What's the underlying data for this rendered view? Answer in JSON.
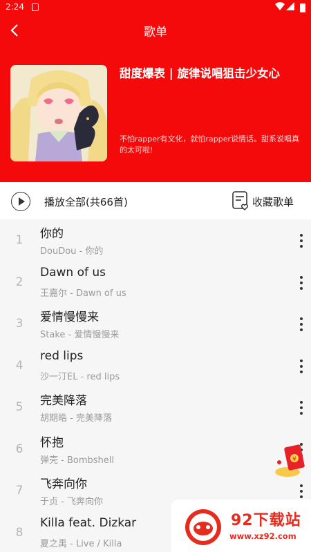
{
  "status_bar": {
    "time": "2:24"
  },
  "nav": {
    "title": "歌单"
  },
  "playlist": {
    "title": "甜度爆表 | 旋律说唱狙击少女心",
    "description": "不怕rapper有文化，就怕rapper说情话。甜系说唱真的太可啦!"
  },
  "actions": {
    "play_all": "播放全部(共66首)",
    "collect": "收藏歌单"
  },
  "songs": [
    {
      "index": "1",
      "title": "你的",
      "subtitle": "DouDou - 你的"
    },
    {
      "index": "2",
      "title": "Dawn of us",
      "subtitle": "王嘉尔 - Dawn of us"
    },
    {
      "index": "3",
      "title": "爱情慢慢来",
      "subtitle": "Stake - 爱情慢慢来"
    },
    {
      "index": "4",
      "title": "red lips",
      "subtitle": "沙一汀EL - red lips"
    },
    {
      "index": "5",
      "title": "完美降落",
      "subtitle": "胡期皓 - 完美降落"
    },
    {
      "index": "6",
      "title": "怀抱",
      "subtitle": "弹壳 - Bombshell"
    },
    {
      "index": "7",
      "title": "飞奔向你",
      "subtitle": "于贞 - 飞奔向你"
    },
    {
      "index": "8",
      "title": "Killa feat. Dizkar",
      "subtitle": "夏之禹 - Live / Killa"
    }
  ],
  "watermark": {
    "brand": "92下载站",
    "url": "www.xz92.com"
  },
  "colors": {
    "accent": "#f40a0a",
    "list_bg": "#f6f6f6"
  },
  "icons": [
    "back-arrow-icon",
    "play-circle-icon",
    "collect-playlist-icon",
    "more-vertical-icon",
    "red-packet-icon"
  ]
}
